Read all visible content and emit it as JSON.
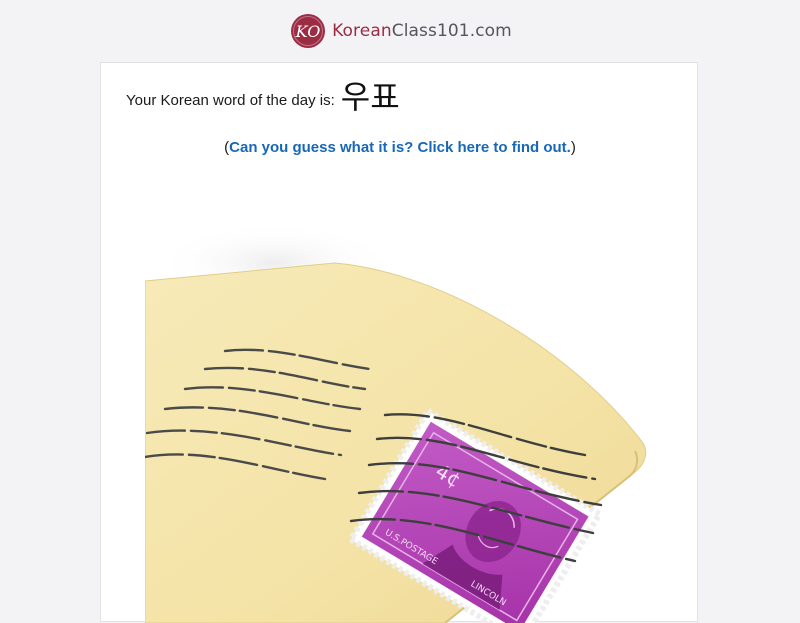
{
  "header": {
    "logo_text_part1": "Korean",
    "logo_text_part2": "Class101.com",
    "logo_mark": "KO"
  },
  "word_of_day": {
    "intro": "Your Korean word of the day is:",
    "korean": "우표"
  },
  "guess": {
    "open_paren": "(",
    "link_text": "Can you guess what it is? Click here to find out.",
    "close_paren": ")"
  },
  "image": {
    "stamp_value": "4¢",
    "stamp_caption": "U.S.POSTAGE",
    "stamp_name": "LINCOLN"
  },
  "colors": {
    "brand": "#9b2c44",
    "link": "#1868b7",
    "envelope": "#f6e8b2",
    "stamp": "#b540b6"
  }
}
